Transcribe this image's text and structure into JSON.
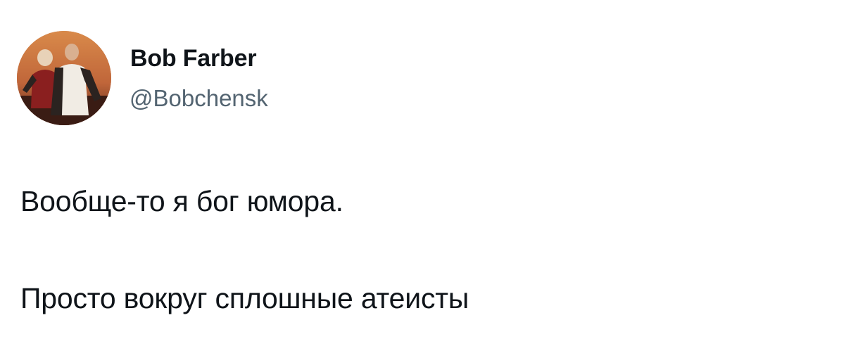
{
  "author": {
    "display_name": "Bob Farber",
    "handle": "@Bobchensk",
    "avatar_icon": "avatar-photo"
  },
  "tweet": {
    "lines": [
      "Вообще-то я бог юмора.",
      "Просто вокруг сплошные атеисты"
    ]
  },
  "colors": {
    "text_primary": "#0f1419",
    "text_secondary": "#536471",
    "background": "#ffffff"
  }
}
